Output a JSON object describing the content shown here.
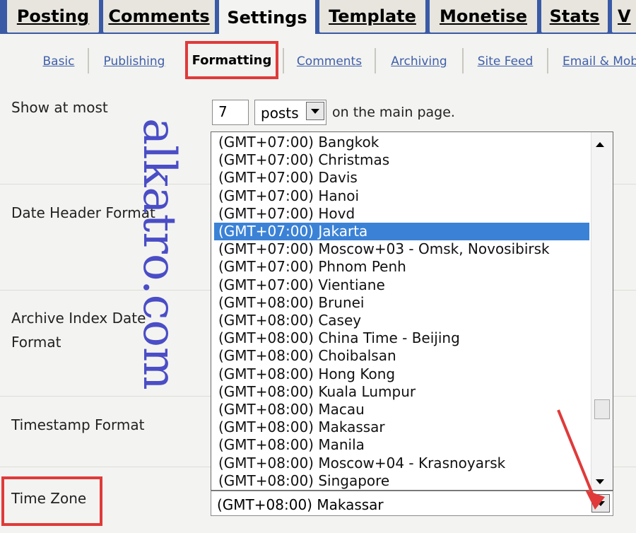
{
  "top_tabs": [
    {
      "label": "Posting"
    },
    {
      "label": "Comments"
    },
    {
      "label": "Settings"
    },
    {
      "label": "Template"
    },
    {
      "label": "Monetise"
    },
    {
      "label": "Stats"
    },
    {
      "label": "V"
    }
  ],
  "sub_tabs": [
    {
      "label": "Basic"
    },
    {
      "label": "Publishing"
    },
    {
      "label": "Formatting"
    },
    {
      "label": "Comments"
    },
    {
      "label": "Archiving"
    },
    {
      "label": "Site Feed"
    },
    {
      "label": "Email & Mob"
    }
  ],
  "form": {
    "show_at_most_label": "Show at most",
    "show_at_most_value": "7",
    "show_unit": "posts",
    "show_trailing": "on the main page.",
    "date_header_label": "Date Header Format",
    "archive_label_line1": "Archive Index Date",
    "archive_label_line2": "Format",
    "timestamp_label": "Timestamp Format",
    "timezone_label": "Time Zone",
    "timezone_value": "(GMT+08:00) Makassar"
  },
  "timezone_options": [
    "(GMT+07:00) Bangkok",
    "(GMT+07:00) Christmas",
    "(GMT+07:00) Davis",
    "(GMT+07:00) Hanoi",
    "(GMT+07:00) Hovd",
    "(GMT+07:00) Jakarta",
    "(GMT+07:00) Moscow+03 - Omsk, Novosibirsk",
    "(GMT+07:00) Phnom Penh",
    "(GMT+07:00) Vientiane",
    "(GMT+08:00) Brunei",
    "(GMT+08:00) Casey",
    "(GMT+08:00) China Time - Beijing",
    "(GMT+08:00) Choibalsan",
    "(GMT+08:00) Hong Kong",
    "(GMT+08:00) Kuala Lumpur",
    "(GMT+08:00) Macau",
    "(GMT+08:00) Makassar",
    "(GMT+08:00) Manila",
    "(GMT+08:00) Moscow+04 - Krasnoyarsk",
    "(GMT+08:00) Singapore"
  ],
  "highlighted_option": "(GMT+07:00) Jakarta",
  "watermark": "alkatro.com",
  "colors": {
    "highlight": "#3b82d6",
    "annotation_red": "#e03a3a",
    "link_blue": "#3f5fa8"
  }
}
